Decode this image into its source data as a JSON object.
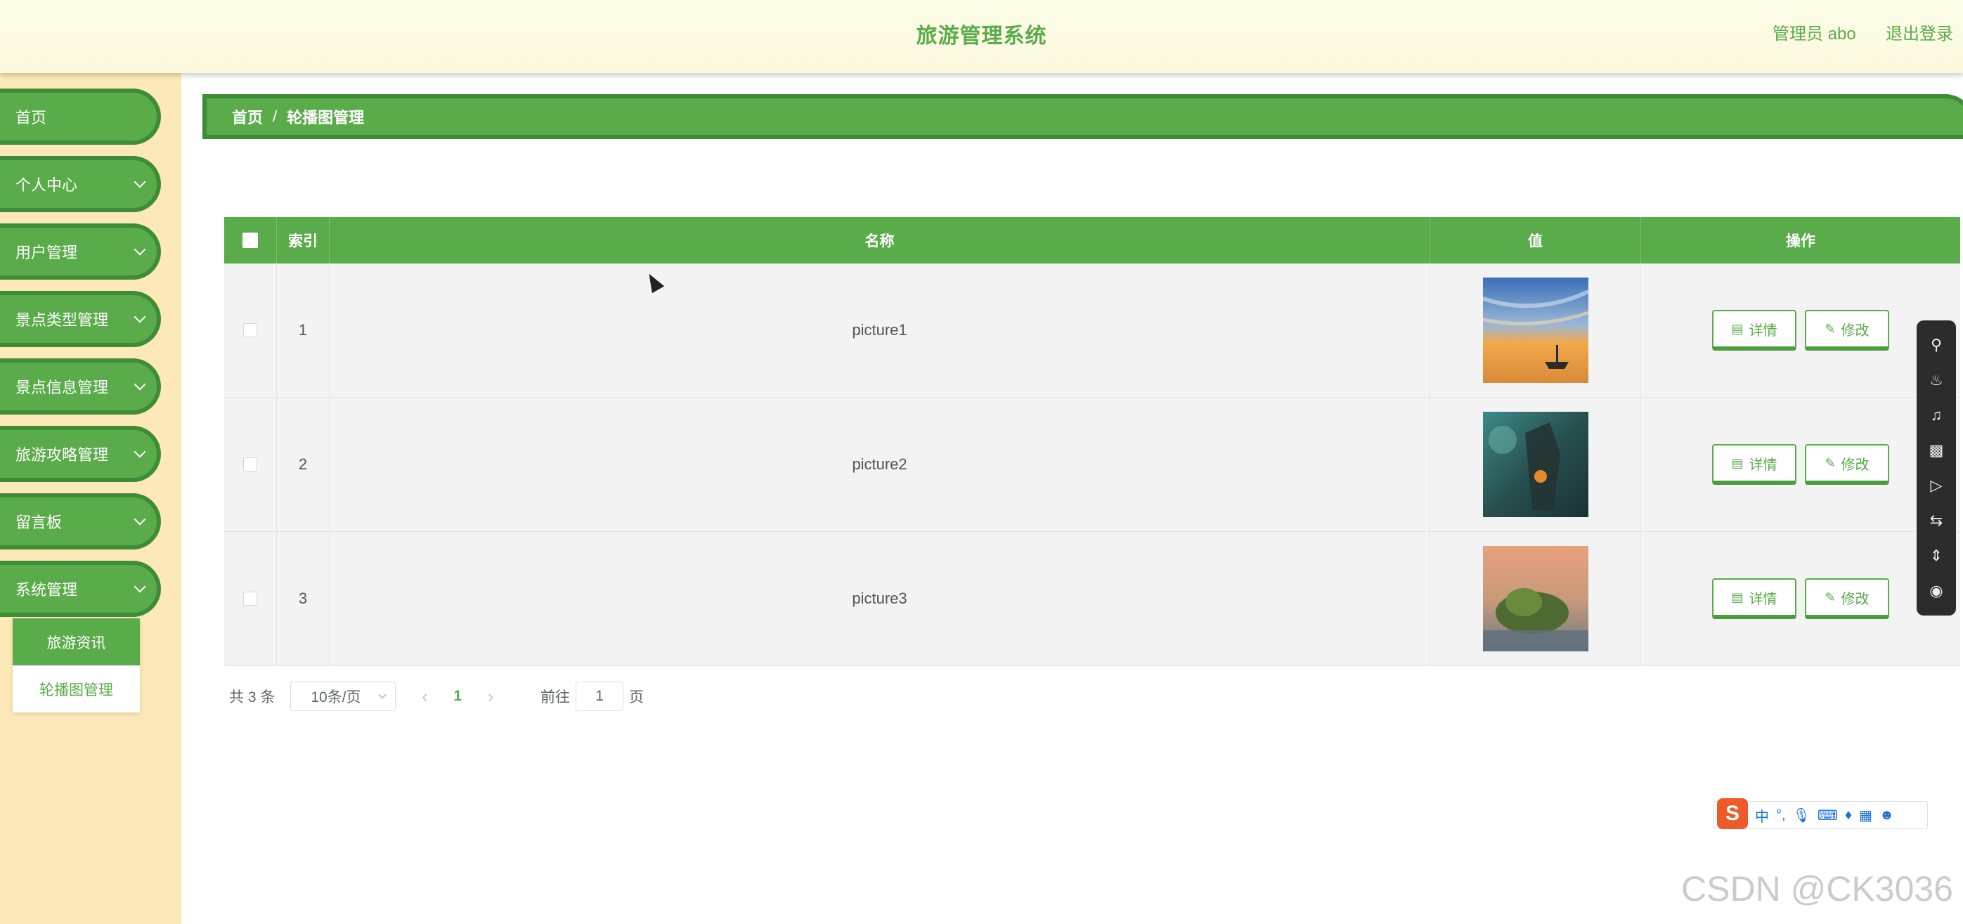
{
  "header": {
    "title": "旅游管理系统",
    "user": "管理员 abo",
    "logout": "退出登录"
  },
  "sidebar": {
    "items": [
      {
        "label": "首页",
        "expandable": false
      },
      {
        "label": "个人中心",
        "expandable": true
      },
      {
        "label": "用户管理",
        "expandable": true
      },
      {
        "label": "景点类型管理",
        "expandable": true
      },
      {
        "label": "景点信息管理",
        "expandable": true
      },
      {
        "label": "旅游攻略管理",
        "expandable": true
      },
      {
        "label": "留言板",
        "expandable": true
      },
      {
        "label": "系统管理",
        "expandable": true
      }
    ],
    "submenu": [
      {
        "label": "旅游资讯",
        "active": true
      },
      {
        "label": "轮播图管理",
        "active": false
      }
    ]
  },
  "breadcrumb": {
    "home": "首页",
    "separator": "/",
    "current": "轮播图管理"
  },
  "table": {
    "columns": {
      "index": "索引",
      "name": "名称",
      "value": "值",
      "ops": "操作"
    },
    "rows": [
      {
        "index": "1",
        "name": "picture1",
        "image": "sunset-boat"
      },
      {
        "index": "2",
        "name": "picture2",
        "image": "dark-house"
      },
      {
        "index": "3",
        "name": "picture3",
        "image": "island-sunset"
      }
    ],
    "detail_label": "详情",
    "edit_label": "修改"
  },
  "pagination": {
    "total": "共 3 条",
    "page_size": "10条/页",
    "current_page": "1",
    "goto_prefix": "前往",
    "goto_value": "1",
    "goto_suffix": "页"
  },
  "ime": {
    "logo": "S",
    "lang": "中",
    "punct": "°,"
  },
  "watermark": "CSDN @CK3036",
  "colors": {
    "primary": "#5aab4a",
    "primary_dark": "#3f8c36",
    "sidebar_bg": "#fde9b8",
    "header_bg": "#fbf9de"
  }
}
